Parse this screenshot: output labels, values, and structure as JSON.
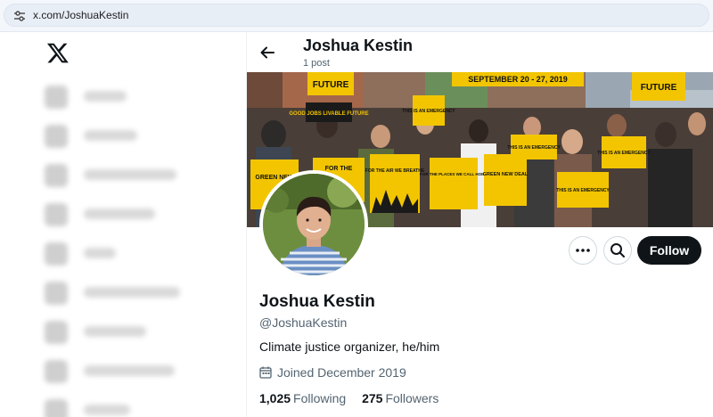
{
  "browser": {
    "url": "x.com/JoshuaKestin"
  },
  "sidebar": {
    "logo_icon": "x-logo-icon",
    "items": [
      {
        "icon": "home-icon",
        "label": "Home"
      },
      {
        "icon": "explore-icon",
        "label": "Explore"
      },
      {
        "icon": "notifications-icon",
        "label": "Notifications"
      },
      {
        "icon": "messages-icon",
        "label": "Messages"
      },
      {
        "icon": "grok-icon",
        "label": "Grok"
      },
      {
        "icon": "communities-icon",
        "label": "Communities"
      },
      {
        "icon": "premium-icon",
        "label": "Premium"
      },
      {
        "icon": "verified-orgs-icon",
        "label": "Verified Orgs"
      },
      {
        "icon": "profile-icon",
        "label": "Profile"
      }
    ]
  },
  "header": {
    "back_icon": "arrow-left-icon",
    "name": "Joshua Kestin",
    "post_count": "1 post"
  },
  "banner": {
    "signs": {
      "top_banner": "SEPTEMBER 20 - 27, 2019",
      "future_left": "FUTURE",
      "future_right": "FUTURE",
      "good_jobs": "GOOD JOBS LIVABLE FUTURE",
      "emergency_1": "THIS IS AN EMERGENCY",
      "emergency_2": "THIS IS AN EMERGENCY",
      "emergency_3": "THIS IS AN EMERGENCY",
      "emergency_4": "THIS IS AN EMERGENCY",
      "green_new": "GREEN NEW",
      "for_the_1": "FOR THE",
      "air_we_breathe": "FOR THE AIR WE BREATHE",
      "places_home": "FOR THE PLACES WE CALL HOME",
      "green_new_deal": "GREEN NEW DEAL"
    }
  },
  "actions": {
    "more_icon": "more-horizontal-icon",
    "search_icon": "search-icon",
    "follow_label": "Follow"
  },
  "profile": {
    "display_name": "Joshua Kestin",
    "handle": "@JoshuaKestin",
    "bio": "Climate justice organizer, he/him",
    "joined_icon": "calendar-icon",
    "joined": "Joined December 2019",
    "following_count": "1,025",
    "following_label": "Following",
    "followers_count": "275",
    "followers_label": "Followers"
  },
  "colors": {
    "accent_dark": "#0f1419",
    "muted_text": "#536471",
    "sign_yellow": "#f2c500"
  }
}
